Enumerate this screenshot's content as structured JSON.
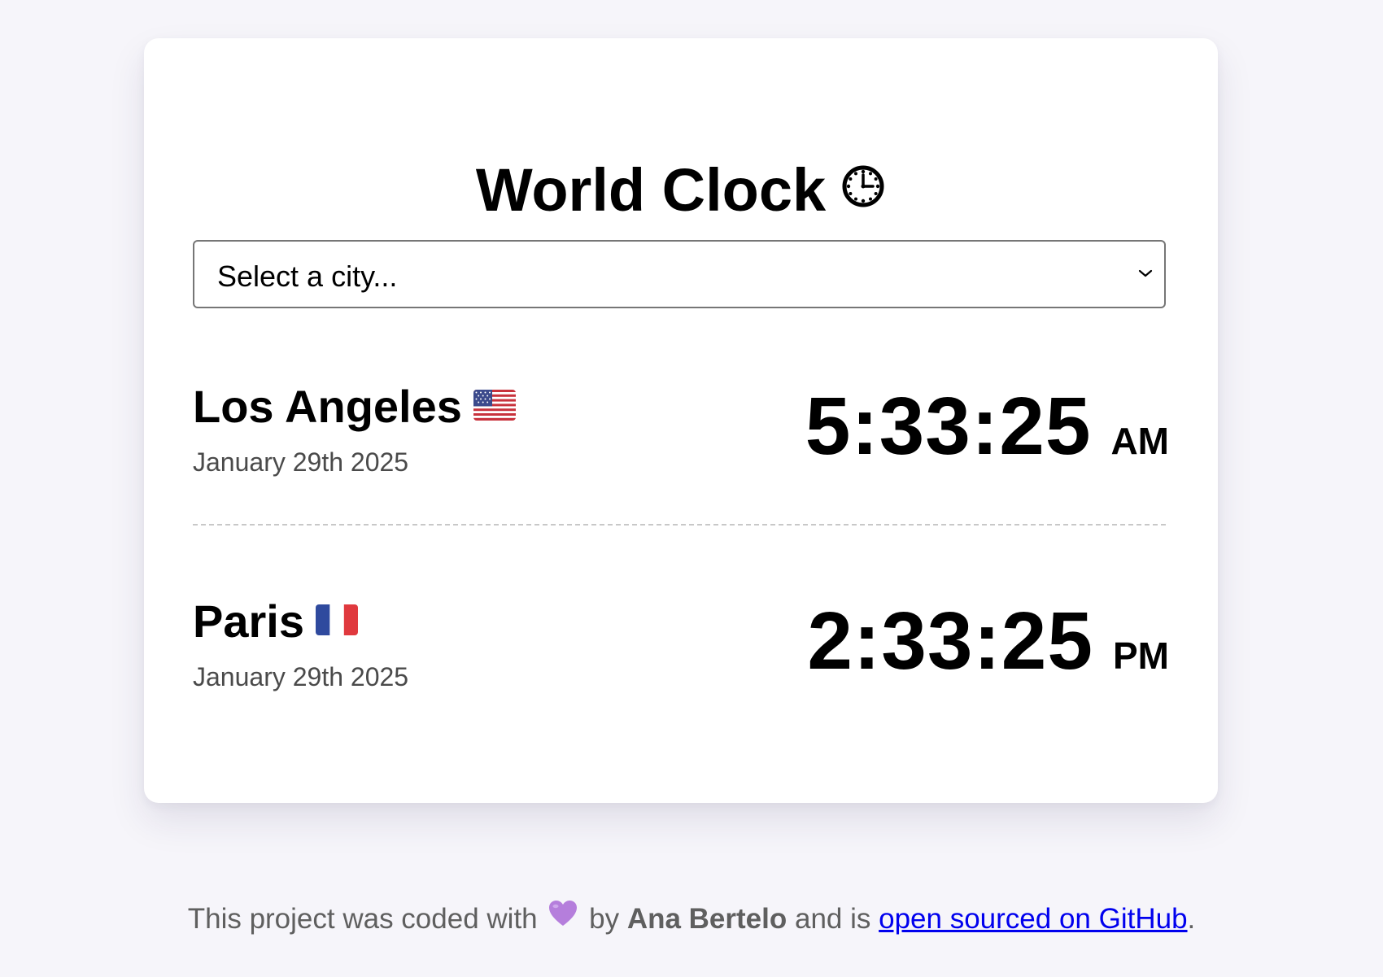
{
  "header": {
    "title": "World Clock",
    "title_icon": "clock-icon"
  },
  "city_select": {
    "placeholder": "Select a city...",
    "selected": "Select a city...",
    "icon": "chevron-down-icon"
  },
  "cities": [
    {
      "name": "Los Angeles",
      "flag": "us-flag-icon",
      "date": "January 29th 2025",
      "time": "5:33:25",
      "period": "AM"
    },
    {
      "name": "Paris",
      "flag": "france-flag-icon",
      "date": "January 29th 2025",
      "time": "2:33:25",
      "period": "PM"
    }
  ],
  "footer": {
    "prefix": "This project was coded with",
    "heart_icon": "purple-heart-icon",
    "by_text": "by",
    "author": "Ana Bertelo",
    "middle_text": "and is",
    "link_text": "open sourced on GitHub",
    "suffix": "."
  },
  "colors": {
    "background": "#f6f5fa",
    "card": "#ffffff",
    "date_text": "#4a4a4a",
    "footer_text": "#5f5f5f",
    "link": "#0000ee",
    "heart": "#b57edc"
  }
}
